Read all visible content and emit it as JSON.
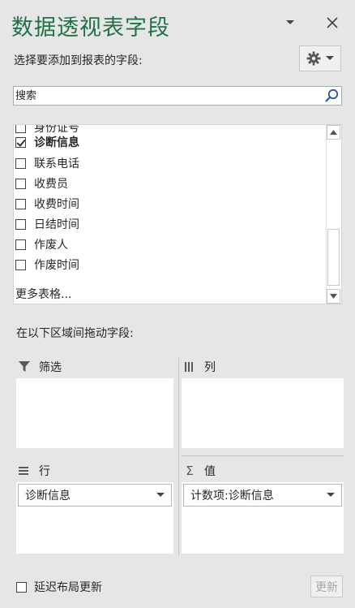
{
  "pane": {
    "title": "数据透视表字段",
    "choose_label": "选择要添加到报表的字段:"
  },
  "search": {
    "placeholder": "搜索"
  },
  "fields": [
    {
      "label": "身份证号",
      "checked": false,
      "partial": true
    },
    {
      "label": "诊断信息",
      "checked": true
    },
    {
      "label": "联系电话",
      "checked": false
    },
    {
      "label": "收费员",
      "checked": false
    },
    {
      "label": "收费时间",
      "checked": false
    },
    {
      "label": "日结时间",
      "checked": false
    },
    {
      "label": "作废人",
      "checked": false
    },
    {
      "label": "作废时间",
      "checked": false
    }
  ],
  "more_tables": "更多表格...",
  "drag_label": "在以下区域间拖动字段:",
  "areas": {
    "filter": {
      "label": "筛选"
    },
    "columns": {
      "label": "列"
    },
    "rows": {
      "label": "行",
      "item": "诊断信息"
    },
    "values": {
      "label": "值",
      "item": "计数项:诊断信息"
    }
  },
  "footer": {
    "defer_label": "延迟布局更新",
    "update_label": "更新"
  },
  "colors": {
    "title": "#217346",
    "accent_search": "#2b579a"
  }
}
